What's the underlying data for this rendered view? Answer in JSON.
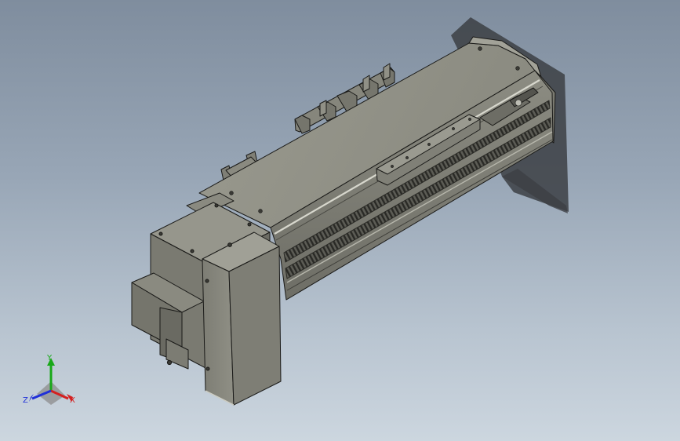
{
  "viewport": {
    "background_top": "#7f8d9e",
    "background_bottom": "#ccd6df",
    "model_shade_color": "#85857b",
    "model_edge_color": "#1a1a18"
  },
  "triad": {
    "x_label": "X",
    "y_label": "Y",
    "z_label": "Z",
    "x_color": "#d42020",
    "y_color": "#18a818",
    "z_color": "#2030d8"
  }
}
